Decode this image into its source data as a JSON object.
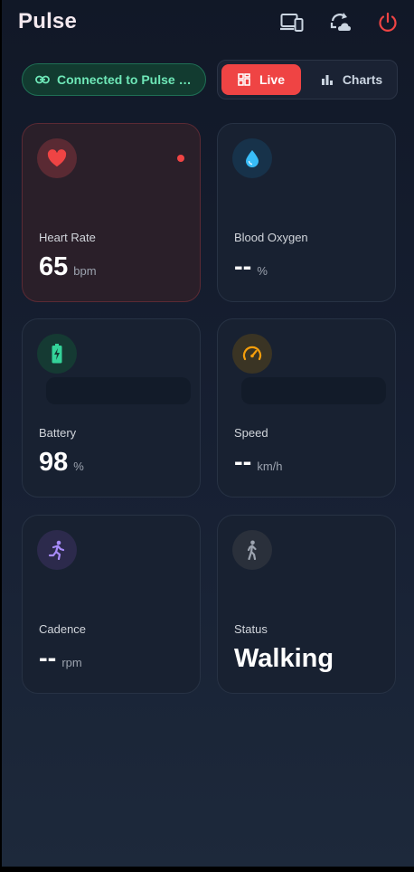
{
  "app": {
    "title": "Pulse"
  },
  "header": {
    "icons": {
      "devices": "devices-icon",
      "sync": "cloud-sync-icon",
      "power": "power-icon"
    },
    "colors": {
      "power": "#ef4444",
      "icon": "#cbd5e1"
    }
  },
  "connection": {
    "text": "Connected to Pulse Ox...",
    "icon": "link-icon",
    "color": "#6ee7b7"
  },
  "view_toggle": {
    "live_label": "Live",
    "charts_label": "Charts",
    "selected": "Live",
    "live_icon": "dashboard-icon",
    "charts_icon": "bar-chart-icon"
  },
  "metrics": {
    "heart_rate": {
      "label": "Heart Rate",
      "value": "65",
      "unit": "bpm",
      "icon": "heart-icon",
      "color": "#ef4444"
    },
    "blood_oxygen": {
      "label": "Blood Oxygen",
      "value": "--",
      "unit": "%",
      "icon": "droplet-icon",
      "color": "#38bdf8"
    },
    "battery": {
      "label": "Battery",
      "value": "98",
      "unit": "%",
      "icon": "battery-charging-icon",
      "color": "#34d399"
    },
    "speed": {
      "label": "Speed",
      "value": "--",
      "unit": "km/h",
      "icon": "speedometer-icon",
      "color": "#f59e0b"
    },
    "cadence": {
      "label": "Cadence",
      "value": "--",
      "unit": "rpm",
      "icon": "running-icon",
      "color": "#a78bfa"
    },
    "status": {
      "label": "Status",
      "value": "Walking",
      "icon": "walking-icon",
      "color": "#9ca3af"
    }
  }
}
